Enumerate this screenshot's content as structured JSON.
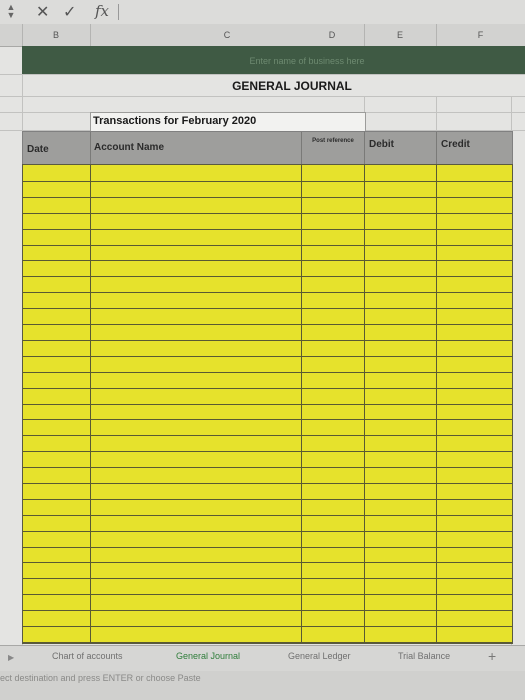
{
  "formula_bar": {
    "cancel_icon": "✕",
    "enter_icon": "✓",
    "fx_label": "fx",
    "value": ""
  },
  "columns": [
    "B",
    "C",
    "D",
    "E",
    "F"
  ],
  "banner": {
    "text": "Enter name of business here"
  },
  "journal": {
    "title": "GENERAL JOURNAL",
    "subtitle": "Transactions for February 2020",
    "headers": {
      "date": "Date",
      "account_name": "Account Name",
      "post_reference": "Post reference",
      "debit": "Debit",
      "credit": "Credit"
    },
    "fill_color": "#e6e22c",
    "banner_color": "#3f5a44"
  },
  "tabs": [
    {
      "label": "Chart of accounts",
      "active": false
    },
    {
      "label": "General Journal",
      "active": true
    },
    {
      "label": "General Ledger",
      "active": false
    },
    {
      "label": "Trial Balance",
      "active": false
    }
  ],
  "tab_add_icon": "+",
  "status": {
    "text": "ect destination and press ENTER or choose Paste"
  }
}
